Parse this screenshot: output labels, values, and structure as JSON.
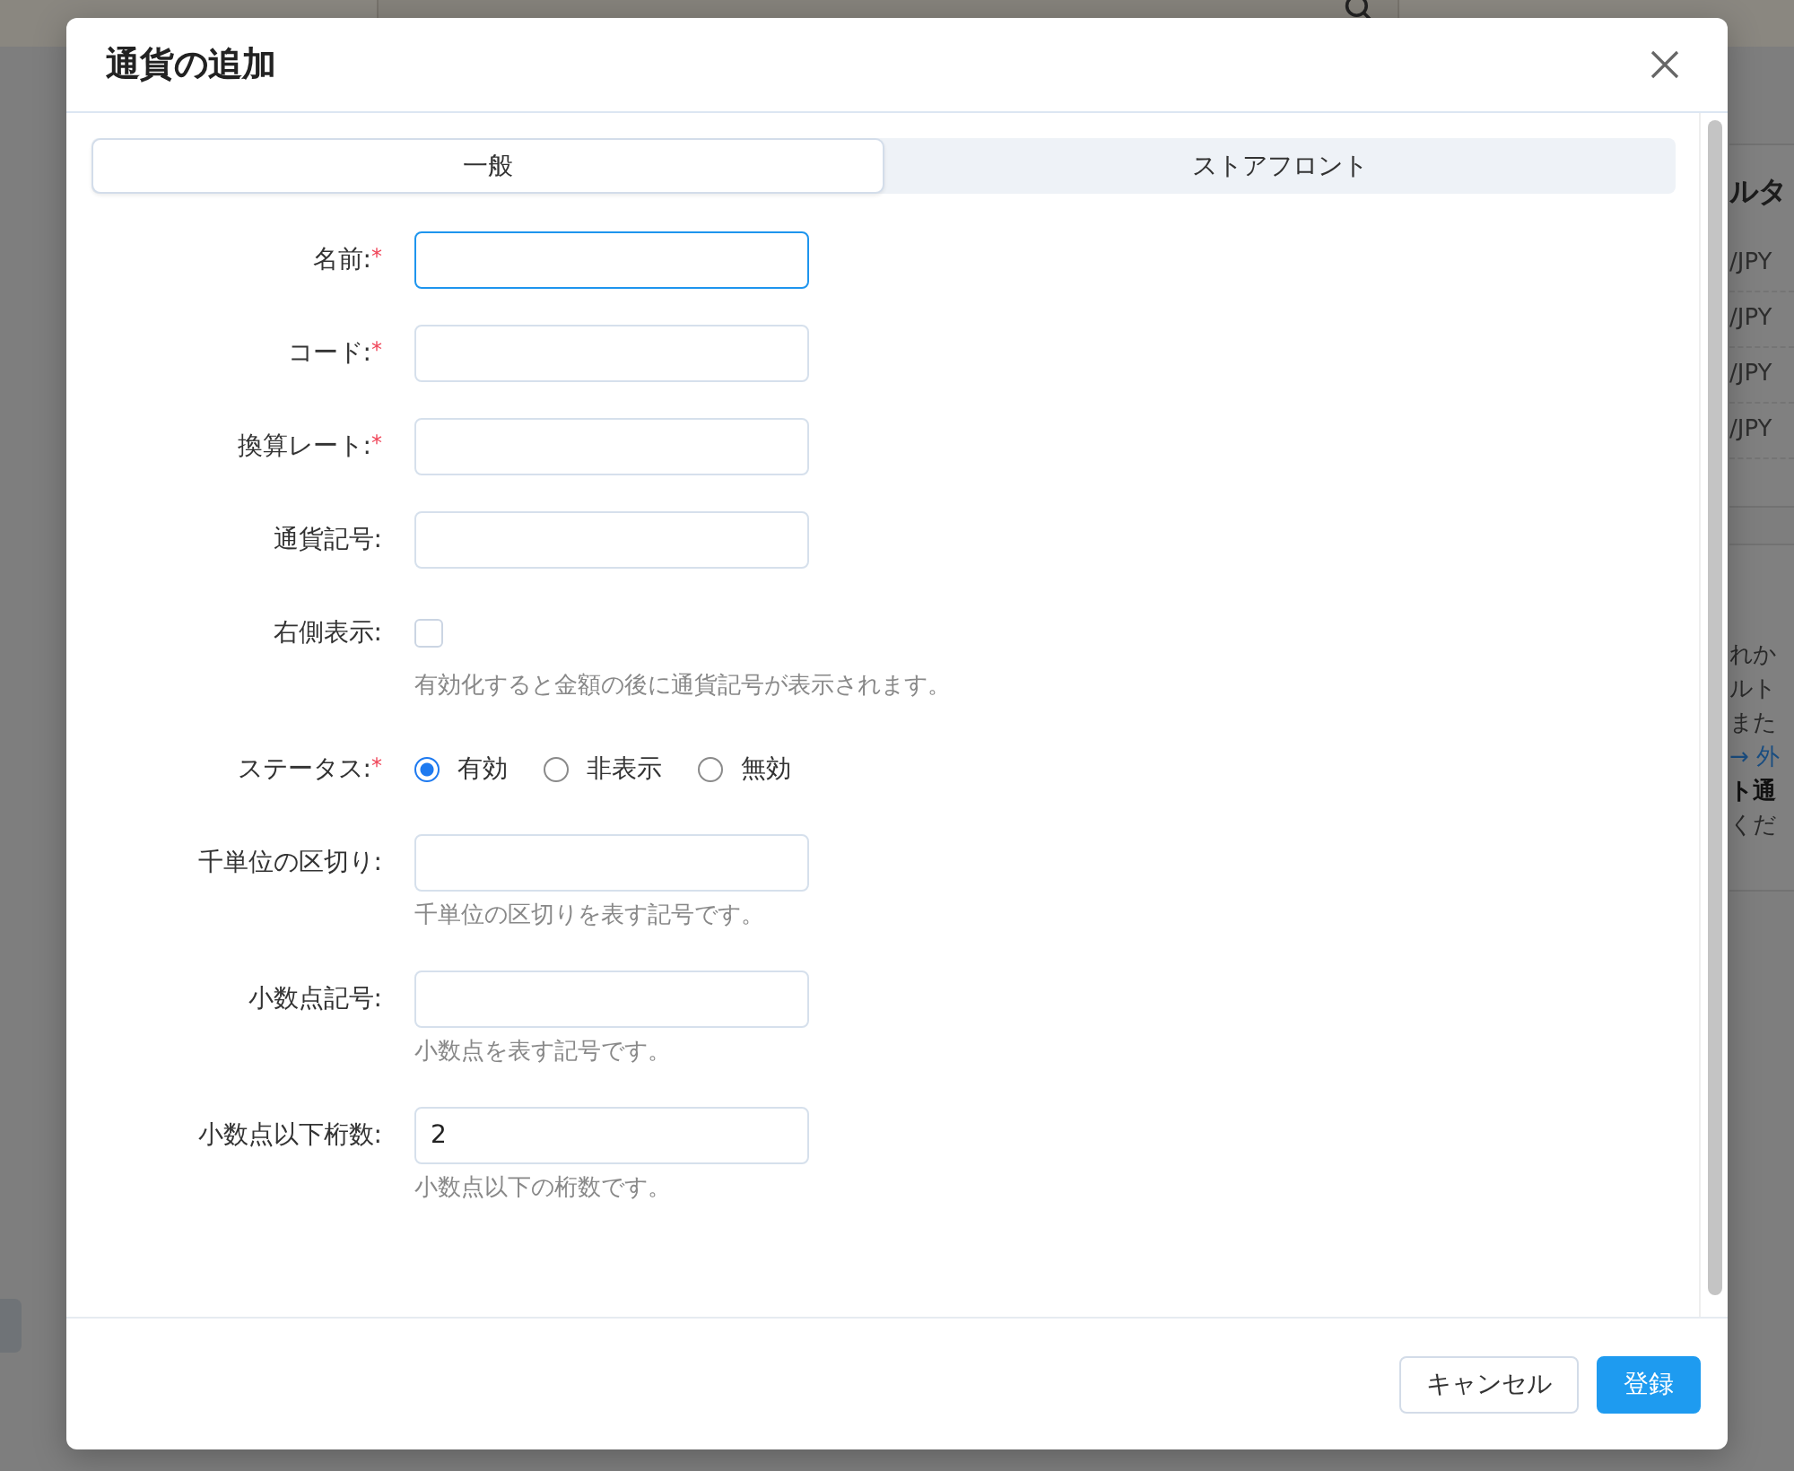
{
  "background": {
    "right_panel": {
      "title": "ルタ",
      "rates": [
        "/JPY",
        "/JPY",
        "/JPY",
        "/JPY"
      ],
      "lines": [
        {
          "text": "れか",
          "kind": "plain"
        },
        {
          "text": "ルト",
          "kind": "plain"
        },
        {
          "text": "また",
          "kind": "plain"
        },
        {
          "text": "→ 外",
          "kind": "link"
        },
        {
          "text": "ト通",
          "kind": "bold"
        },
        {
          "text": "くだ",
          "kind": "plain"
        }
      ]
    }
  },
  "dialog": {
    "title": "通貨の追加",
    "tabs": [
      {
        "label": "一般",
        "selected": true
      },
      {
        "label": "ストアフロント",
        "selected": false
      }
    ],
    "fields": [
      {
        "kind": "text",
        "label": "名前:",
        "required_mark": "*",
        "focused": true
      },
      {
        "kind": "text",
        "label": "コード:",
        "required_mark": "*",
        "focused": false
      },
      {
        "kind": "text",
        "label": "換算レート:",
        "required_mark": "*",
        "focused": false
      },
      {
        "kind": "text",
        "label": "通貨記号:",
        "focused": false
      },
      {
        "kind": "checkbox",
        "label": "右側表示:",
        "checked": false,
        "help": "有効化すると金額の後に通貨記号が表示されます。"
      },
      {
        "kind": "radio",
        "label": "ステータス:",
        "required_mark": "*",
        "options": [
          {
            "label": "有効",
            "selected": true
          },
          {
            "label": "非表示",
            "selected": false
          },
          {
            "label": "無効",
            "selected": false
          }
        ]
      },
      {
        "kind": "text",
        "label": "千単位の区切り:",
        "focused": false,
        "help": "千単位の区切りを表す記号です。"
      },
      {
        "kind": "text",
        "label": "小数点記号:",
        "focused": false,
        "help": "小数点を表す記号です。"
      },
      {
        "kind": "text",
        "label": "小数点以下桁数:",
        "focused": false,
        "value": "2",
        "help": "小数点以下の桁数です。"
      }
    ],
    "buttons": [
      {
        "label": "キャンセル",
        "kind": "secondary"
      },
      {
        "label": "登録",
        "kind": "primary"
      }
    ]
  }
}
